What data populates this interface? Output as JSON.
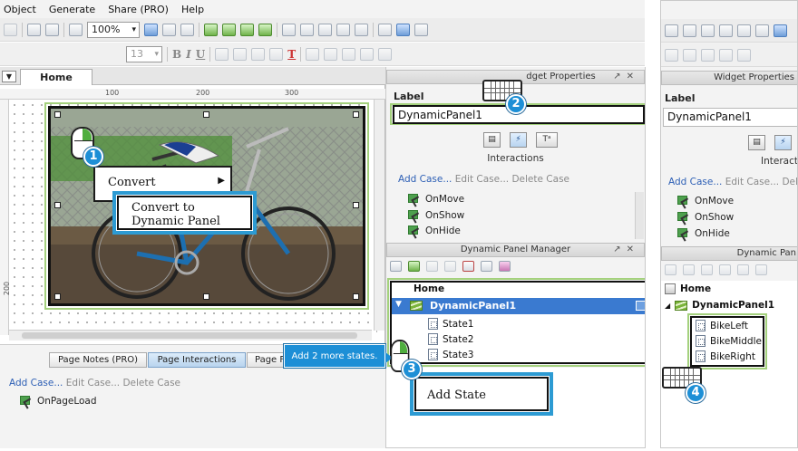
{
  "menu": [
    "Object",
    "Generate",
    "Share (PRO)",
    "Help"
  ],
  "toolbar": {
    "zoom": "100%",
    "font_size": "13",
    "bold": "B",
    "italic": "I",
    "underline": "U",
    "text_color": "T"
  },
  "canvas": {
    "tab": "Home",
    "ruler": [
      "100",
      "200",
      "300"
    ],
    "vruler": [
      "200"
    ]
  },
  "context_menu": {
    "convert": "Convert",
    "convert_to": "Convert to\nDynamic Panel"
  },
  "bottom_tabs": [
    "Page Notes (PRO)",
    "Page Interactions",
    "Page F"
  ],
  "page_interactions": {
    "add": "Add Case...",
    "edit": "Edit Case...",
    "delete": "Delete Case",
    "event": "OnPageLoad"
  },
  "widget_props": {
    "title": "Widget Properties",
    "title_visible": "dget Properties",
    "label_heading": "Label",
    "label_value": "DynamicPanel1",
    "tab_icons": [
      "▤",
      "⚡",
      "Tᵃ"
    ],
    "interactions_heading": "Interactions",
    "add": "Add Case...",
    "edit": "Edit Case...",
    "delete": "Delete Case",
    "events": [
      "OnMove",
      "OnShow",
      "OnHide"
    ]
  },
  "dp_manager": {
    "title": "Dynamic Panel Manager",
    "home": "Home",
    "panel": "DynamicPanel1",
    "states": [
      "State1",
      "State2",
      "State3"
    ]
  },
  "hint": "Add 2 more states.",
  "add_state": "Add State",
  "right": {
    "widget_props_title": "Widget Properties",
    "label_heading": "Label",
    "label_value": "DynamicPanel1",
    "interactions_heading": "Interacti",
    "add": "Add Case...",
    "edit": "Edit Case...",
    "delete": "Dele",
    "events": [
      "OnMove",
      "OnShow",
      "OnHide"
    ],
    "dp_title": "Dynamic Pan",
    "home": "Home",
    "panel": "DynamicPanel1",
    "states": [
      "BikeLeft",
      "BikeMiddle",
      "BikeRight"
    ]
  },
  "badges": [
    "1",
    "2",
    "3",
    "4"
  ]
}
